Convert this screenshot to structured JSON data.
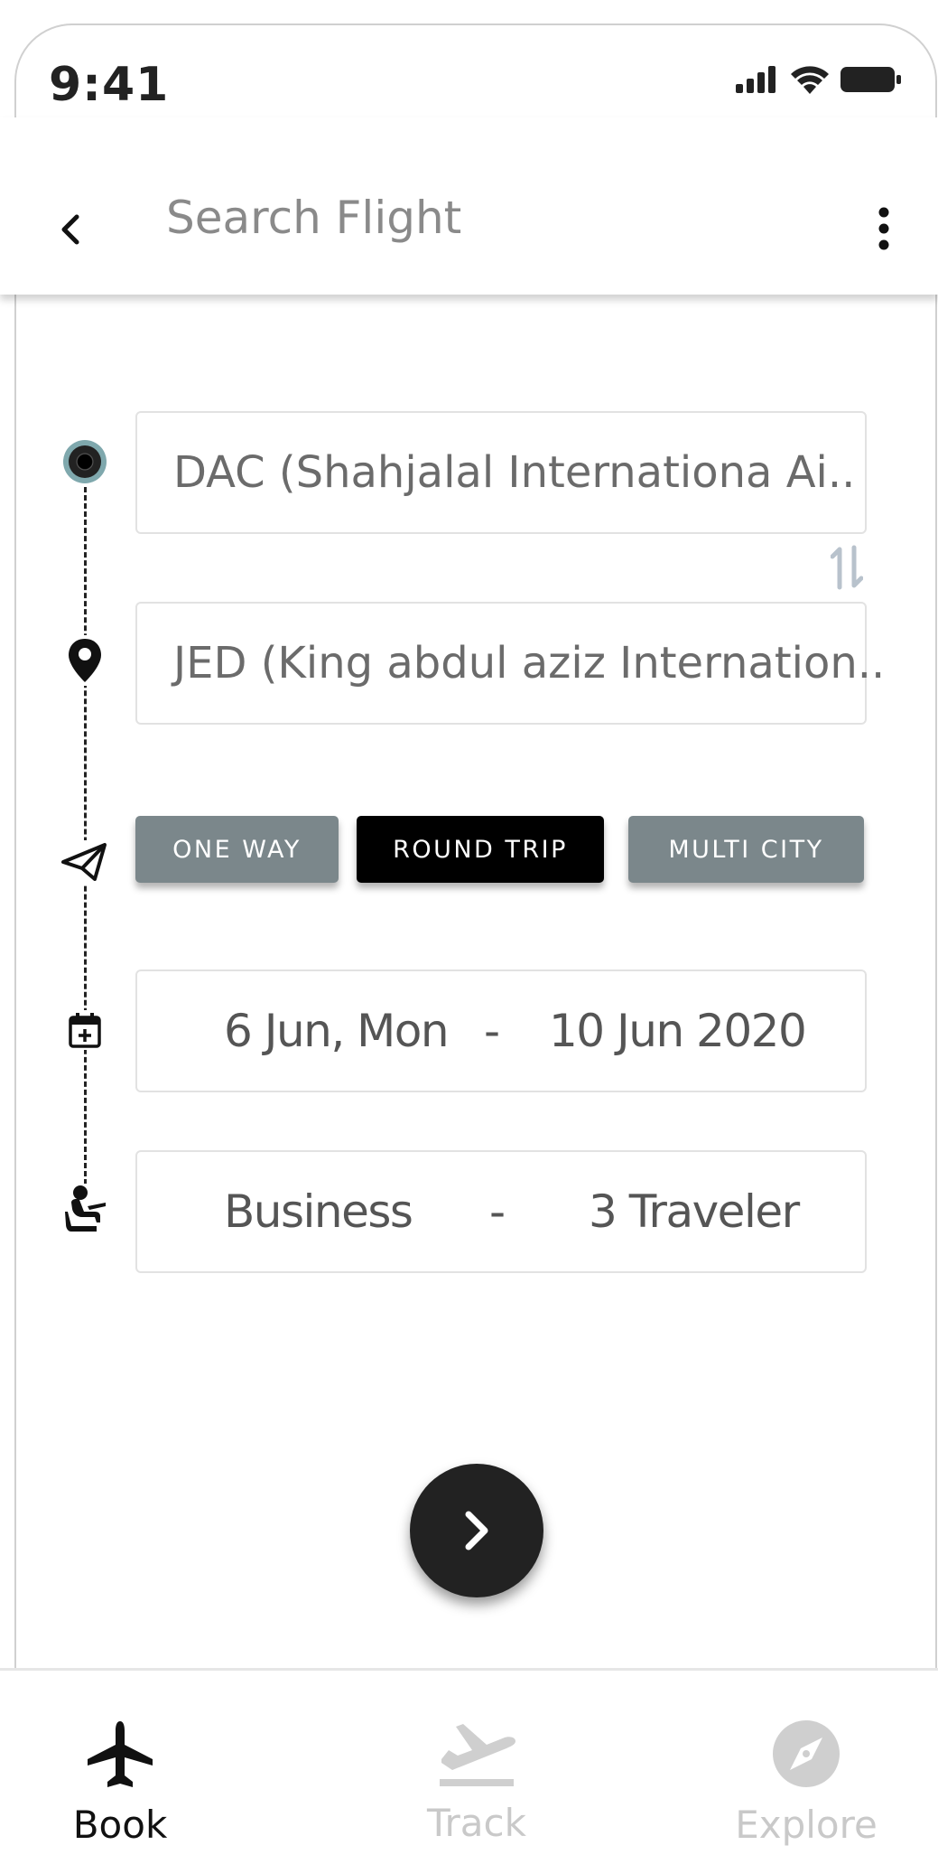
{
  "status_bar": {
    "time": "9:41"
  },
  "app_bar": {
    "title": "Search Flight"
  },
  "form": {
    "from": "DAC (Shahjalal Internationa Ai..",
    "to": "JED (King abdul aziz Internation..",
    "trip_types": [
      {
        "label": "ONE WAY",
        "selected": false
      },
      {
        "label": "ROUND TRIP",
        "selected": true
      },
      {
        "label": "MULTI CITY",
        "selected": false
      }
    ],
    "dates": {
      "depart": "6 Jun, Mon",
      "separator": "-",
      "return": "10 Jun 2020"
    },
    "cabin": {
      "class": "Business",
      "separator": "-",
      "travelers": "3 Traveler"
    }
  },
  "bottom_nav": [
    {
      "label": "Book",
      "icon": "airplane-icon",
      "active": true
    },
    {
      "label": "Track",
      "icon": "flight-takeoff-icon",
      "active": false
    },
    {
      "label": "Explore",
      "icon": "compass-icon",
      "active": false
    }
  ],
  "colors": {
    "selected_trip": "#000000",
    "unselected_trip": "#7b878b",
    "inactive_nav": "#c9c9c9"
  }
}
